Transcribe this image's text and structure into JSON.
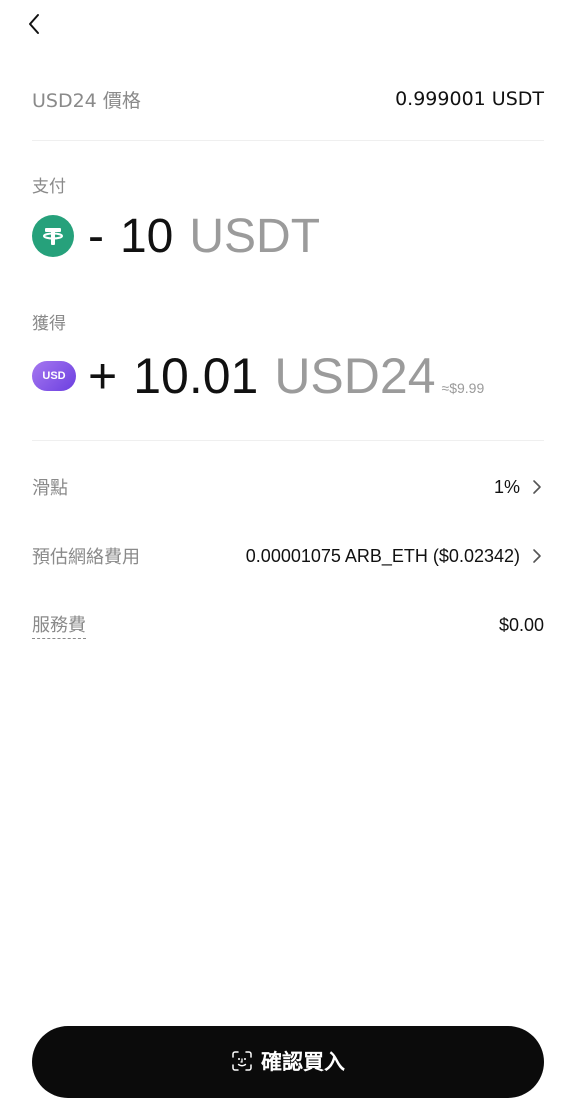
{
  "price": {
    "label": "USD24 價格",
    "value": "0.999001 USDT"
  },
  "pay": {
    "label": "支付",
    "sign": "-",
    "amount": "10",
    "unit": "USDT",
    "icon": "usdt-tether-icon",
    "color": "#26a17b"
  },
  "receive": {
    "label": "獲得",
    "sign": "+",
    "amount": "10.01",
    "unit": "USD24",
    "approx": "≈$9.99",
    "icon_text": "USD",
    "color": "#7b4fe8"
  },
  "details": [
    {
      "label": "滑點",
      "value": "1%"
    },
    {
      "label": "預估網絡費用",
      "value": "0.00001075 ARB_ETH ($0.02342)"
    },
    {
      "label": "服務費",
      "value": "$0.00"
    }
  ],
  "confirm": {
    "label": "確認買入",
    "icon": "face-id-icon"
  }
}
